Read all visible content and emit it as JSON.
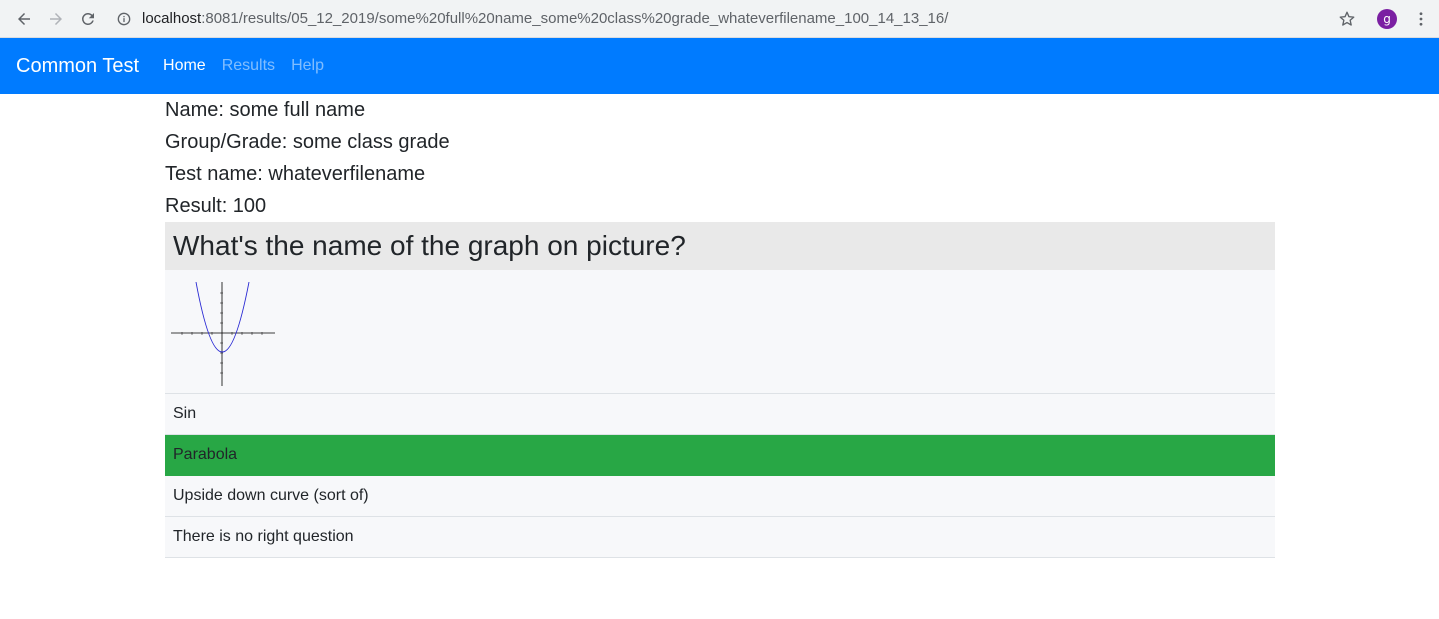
{
  "browser": {
    "url_host": "localhost",
    "url_rest": ":8081/results/05_12_2019/some%20full%20name_some%20class%20grade_whateverfilename_100_14_13_16/",
    "avatar_letter": "g"
  },
  "navbar": {
    "brand": "Common Test",
    "links": [
      {
        "label": "Home"
      },
      {
        "label": "Results"
      },
      {
        "label": "Help"
      }
    ]
  },
  "result": {
    "name": "Name: some full name",
    "group": "Group/Grade: some class grade",
    "test_name": "Test name: whateverfilename",
    "score": "Result: 100"
  },
  "question": {
    "text": "What's the name of the graph on picture?",
    "picture_icon": "parabola-graph",
    "answers": [
      {
        "label": "Sin",
        "correct": false
      },
      {
        "label": "Parabola",
        "correct": true
      },
      {
        "label": "Upside down curve (sort of)",
        "correct": false
      },
      {
        "label": "There is no right question",
        "correct": false
      }
    ],
    "colors": {
      "correct": "#28a745",
      "navbar": "#007bff"
    }
  }
}
